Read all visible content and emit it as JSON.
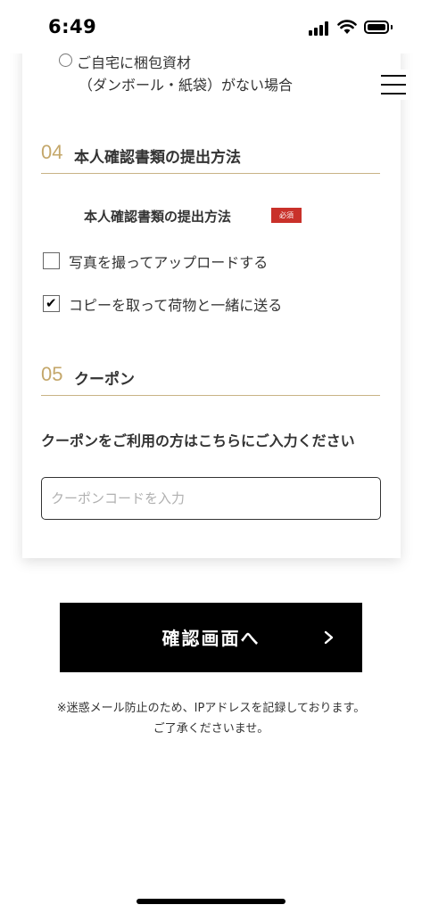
{
  "status_bar": {
    "time": "6:49"
  },
  "delivery_option": {
    "label_line1": "ご自宅に梱包資材",
    "label_line2": "（ダンボール・紙袋）がない場合",
    "selected": false
  },
  "section04": {
    "number": "04",
    "title": "本人確認書類の提出方法",
    "field_label": "本人確認書類の提出方法",
    "required_badge": "必須",
    "options": [
      {
        "label": "写真を撮ってアップロードする",
        "checked": false
      },
      {
        "label": "コピーを取って荷物と一緒に送る",
        "checked": true
      }
    ]
  },
  "section05": {
    "number": "05",
    "title": "クーポン",
    "question": "クーポンをご利用の方はこちらにご入力ください",
    "input_value": "",
    "input_placeholder": "クーポンコードを入力"
  },
  "confirm_button": {
    "label": "確認画面へ"
  },
  "notice": {
    "line1": "※迷惑メール防止のため、IPアドレスを記録しております。",
    "line2": "ご了承くださいませ。"
  },
  "icons": {
    "menu": "hamburger-icon",
    "arrow": "chevron-right-icon",
    "check": "checkmark-icon"
  }
}
